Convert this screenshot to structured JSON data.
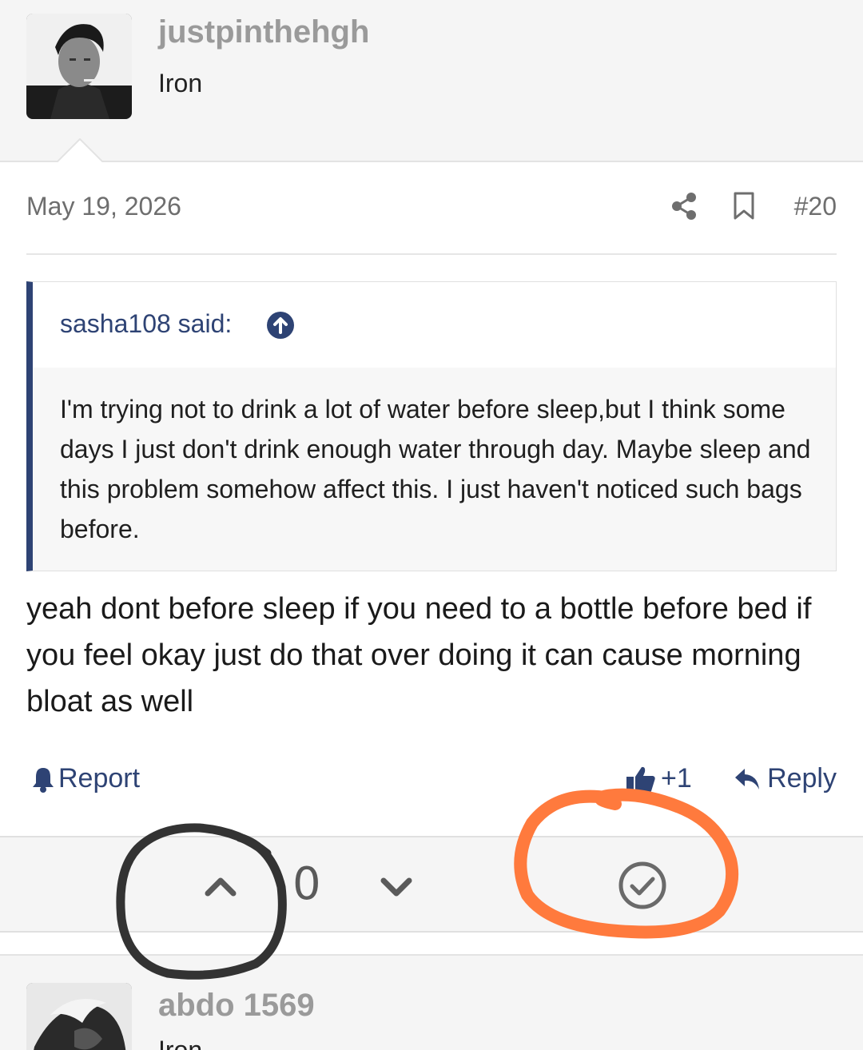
{
  "post": {
    "author": {
      "username": "justpinthehgh",
      "title": "Iron",
      "avatar_icon": "avatar-photo"
    },
    "date": "May 19, 2026",
    "number": "#20",
    "share_icon": "share-icon",
    "bookmark_icon": "bookmark-icon",
    "quote": {
      "author_line": "sasha108 said:",
      "text": "I'm trying not to drink a lot of water before sleep,but I think some days I just don't drink enough water through day. Maybe sleep and this problem somehow affect this. I just haven't noticed such bags before."
    },
    "body": "yeah dont before sleep if you need to a bottle before bed if you feel okay just do that over doing it can cause morning bloat as well",
    "actions": {
      "report_label": "Report",
      "like_label": "+1",
      "reply_label": "Reply"
    },
    "votes": {
      "count": "0"
    }
  },
  "next_post": {
    "author": {
      "username": "abdo 1569",
      "title": "Iron"
    }
  },
  "colors": {
    "accent": "#2e4374",
    "annotation_black": "#333333",
    "annotation_orange": "#ff7a3d"
  }
}
